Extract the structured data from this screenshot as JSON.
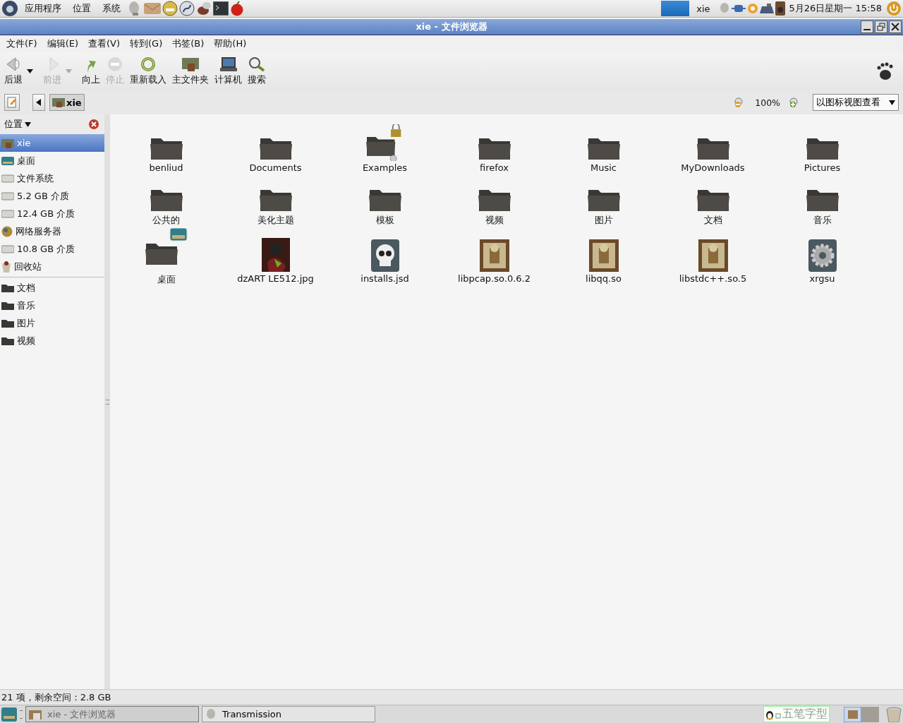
{
  "top_panel": {
    "menus": [
      "应用程序",
      "位置",
      "系统"
    ],
    "user": "xie",
    "clock": "5月26日星期一  15:58"
  },
  "window": {
    "title": "xie - 文件浏览器"
  },
  "menubar": [
    "文件(F)",
    "编辑(E)",
    "查看(V)",
    "转到(G)",
    "书签(B)",
    "帮助(H)"
  ],
  "toolbar": [
    {
      "kind": "back",
      "label": "后退",
      "disabled": false,
      "dropdown": true
    },
    {
      "kind": "forward",
      "label": "前进",
      "disabled": true,
      "dropdown": true
    },
    {
      "kind": "up",
      "label": "向上",
      "disabled": false,
      "dropdown": false
    },
    {
      "kind": "stop",
      "label": "停止",
      "disabled": true,
      "dropdown": false
    },
    {
      "kind": "reload",
      "label": "重新载入",
      "disabled": false,
      "dropdown": false
    },
    {
      "kind": "home",
      "label": "主文件夹",
      "disabled": false,
      "dropdown": false
    },
    {
      "kind": "computer",
      "label": "计算机",
      "disabled": false,
      "dropdown": false
    },
    {
      "kind": "search",
      "label": "搜索",
      "disabled": false,
      "dropdown": false
    }
  ],
  "location_bar": {
    "path": [
      {
        "label": "xie",
        "selected": true
      }
    ],
    "zoom": "100%",
    "view_mode": "以图标视图查看"
  },
  "sidebar": {
    "title": "位置",
    "groups": [
      [
        {
          "kind": "home",
          "label": "xie",
          "selected": true
        },
        {
          "kind": "desktop",
          "label": "桌面",
          "selected": false
        },
        {
          "kind": "drive",
          "label": "文件系统",
          "selected": false
        },
        {
          "kind": "drive",
          "label": "5.2 GB 介质",
          "selected": false
        },
        {
          "kind": "drive",
          "label": "12.4 GB 介质",
          "selected": false
        },
        {
          "kind": "network",
          "label": "网络服务器",
          "selected": false
        },
        {
          "kind": "drive",
          "label": "10.8 GB 介质",
          "selected": false
        },
        {
          "kind": "trash",
          "label": "回收站",
          "selected": false
        }
      ],
      [
        {
          "kind": "folder",
          "label": "文档",
          "selected": false
        },
        {
          "kind": "folder",
          "label": "音乐",
          "selected": false
        },
        {
          "kind": "folder",
          "label": "图片",
          "selected": false
        },
        {
          "kind": "folder",
          "label": "视频",
          "selected": false
        }
      ]
    ]
  },
  "files": [
    {
      "kind": "folder",
      "name": "benliud"
    },
    {
      "kind": "folder",
      "name": "Documents"
    },
    {
      "kind": "locked-folder",
      "name": "Examples"
    },
    {
      "kind": "folder",
      "name": "firefox"
    },
    {
      "kind": "folder",
      "name": "Music"
    },
    {
      "kind": "folder",
      "name": "MyDownloads"
    },
    {
      "kind": "folder",
      "name": "Pictures"
    },
    {
      "kind": "folder",
      "name": "公共的"
    },
    {
      "kind": "folder",
      "name": "美化主题"
    },
    {
      "kind": "folder",
      "name": "模板"
    },
    {
      "kind": "folder",
      "name": "视频"
    },
    {
      "kind": "folder",
      "name": "图片"
    },
    {
      "kind": "folder",
      "name": "文档"
    },
    {
      "kind": "folder",
      "name": "音乐"
    },
    {
      "kind": "desktop-folder",
      "name": "桌面"
    },
    {
      "kind": "image",
      "name": "dzART LE512.jpg"
    },
    {
      "kind": "skull",
      "name": "installs.jsd"
    },
    {
      "kind": "package",
      "name": "libpcap.so.0.6.2"
    },
    {
      "kind": "package",
      "name": "libqq.so"
    },
    {
      "kind": "package",
      "name": "libstdc++.so.5"
    },
    {
      "kind": "gear",
      "name": "xrgsu"
    }
  ],
  "status_bar": "21 项，剩余空间：2.8 GB",
  "taskbar": {
    "tasks": [
      {
        "label": "xie - 文件浏览器",
        "selected": true
      },
      {
        "label": "Transmission",
        "selected": false
      }
    ],
    "input_method": "五笔字型"
  }
}
